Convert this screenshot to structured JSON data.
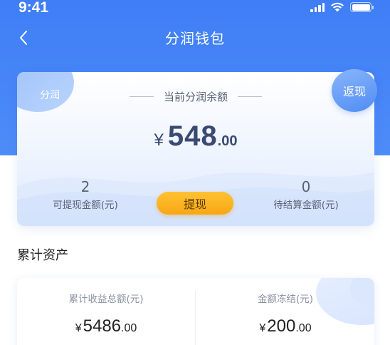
{
  "status_bar": {
    "time": "9:41"
  },
  "nav": {
    "title": "分润钱包"
  },
  "balance_card": {
    "tag_left": "分润",
    "tag_right": "返现",
    "label": "当前分润余额",
    "currency": "¥",
    "amount_int": "548",
    "amount_dec": ".00",
    "withdrawable": {
      "value": "2",
      "label": "可提现金额(元)"
    },
    "pending": {
      "value": "0",
      "label": "待结算金额(元)"
    },
    "withdraw_button": "提现"
  },
  "assets": {
    "section_title": "累计资产",
    "total_income": {
      "label": "累计收益总额(元)",
      "currency": "¥",
      "int": "5486",
      "dec": ".00"
    },
    "frozen": {
      "label": "金额冻结(元)",
      "currency": "¥",
      "int": "200",
      "dec": ".00"
    }
  },
  "colors": {
    "header": "#3f7ef6",
    "withdraw_button": "#f8a614",
    "balance_text": "#3b4a72"
  }
}
